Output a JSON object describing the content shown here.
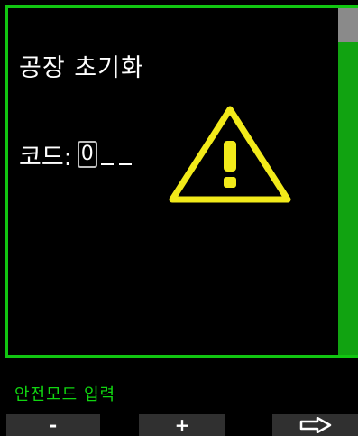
{
  "screen": {
    "title": "공장 초기화",
    "code_label": "코드:",
    "code_digit": "0"
  },
  "status_text": "안전모드 입력",
  "softkeys": {
    "minus": "-",
    "plus": "+",
    "next_icon": "arrow-right-outline-icon"
  },
  "colors": {
    "accent_green": "#11c611",
    "warning_yellow": "#f2ea1a",
    "background": "#000000"
  }
}
